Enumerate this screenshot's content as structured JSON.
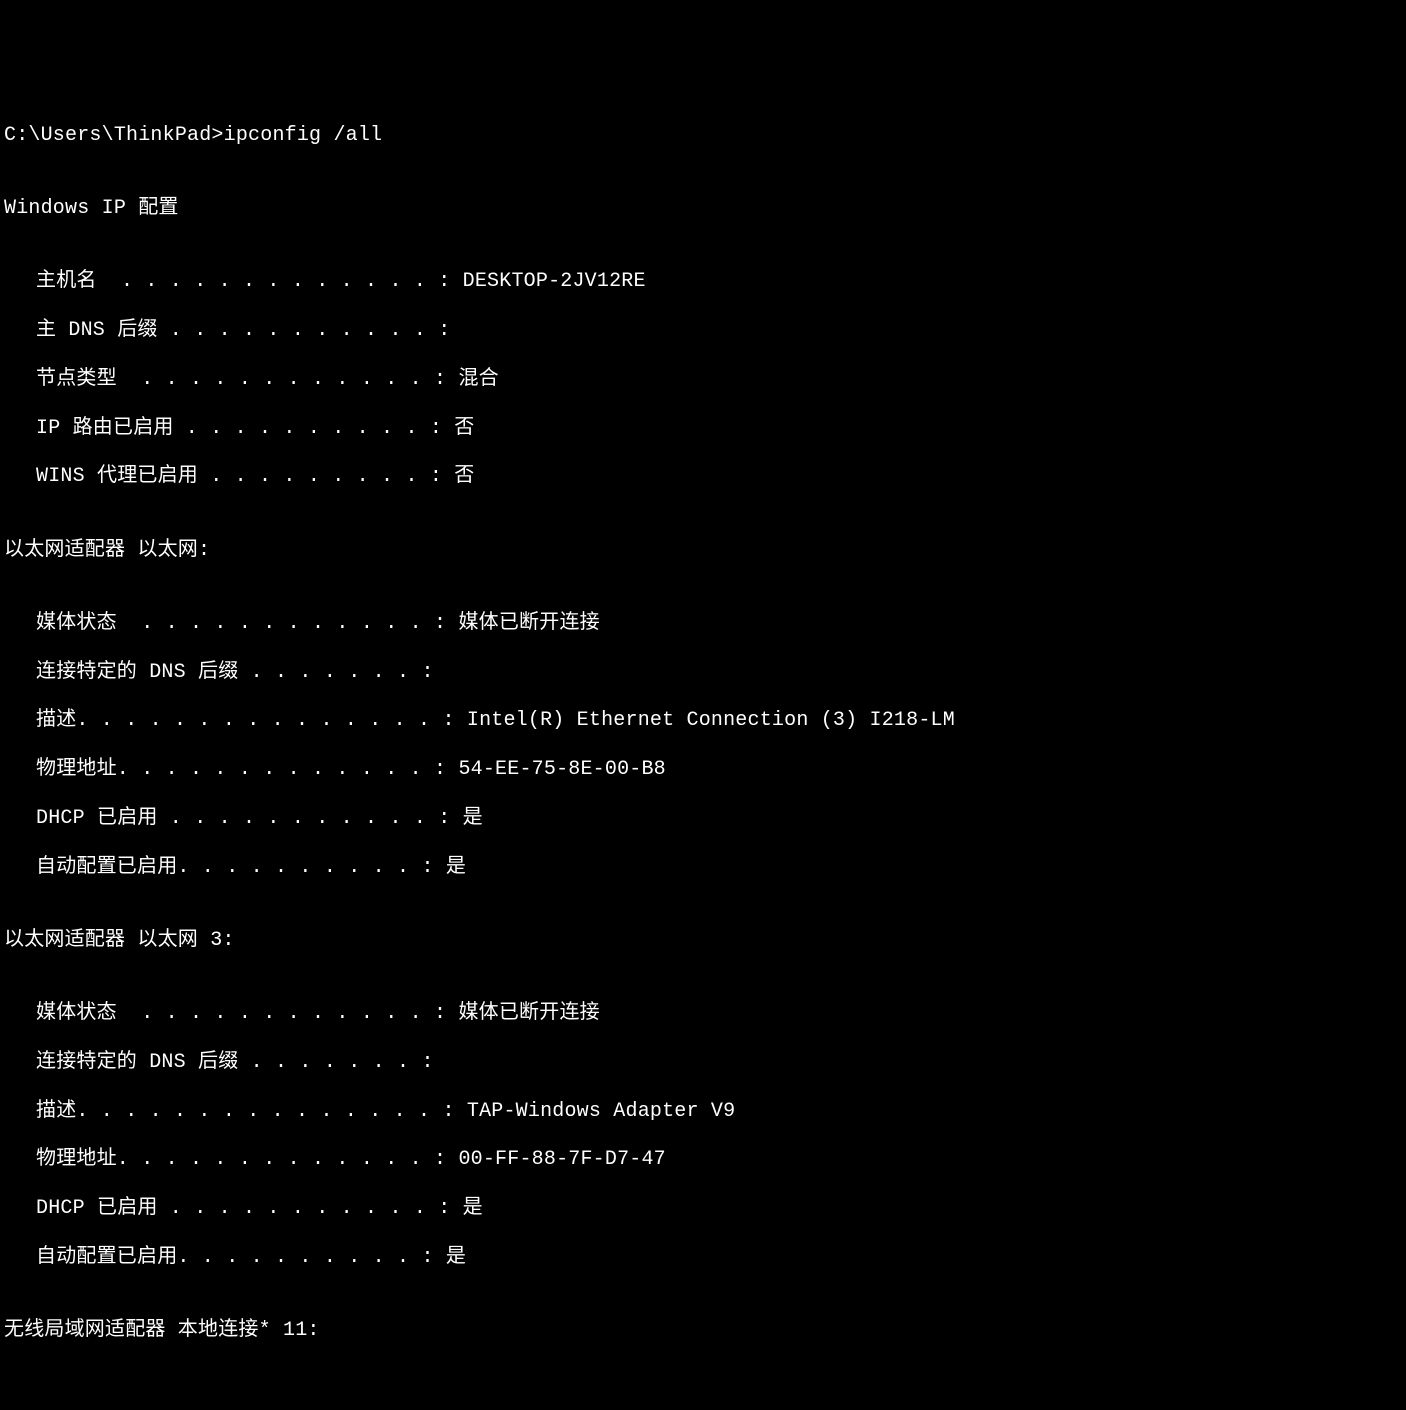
{
  "prompt": "C:\\Users\\ThinkPad>ipconfig /all",
  "blank": "",
  "header": "Windows IP 配置",
  "host": {
    "hostname_label": "主机名  . . . . . . . . . . . . . : DESKTOP-2JV12RE",
    "dns_suffix_label": "主 DNS 后缀 . . . . . . . . . . . :",
    "node_type_label": "节点类型  . . . . . . . . . . . . : 混合",
    "ip_routing_label": "IP 路由已启用 . . . . . . . . . . : 否",
    "wins_proxy_label": "WINS 代理已启用 . . . . . . . . . : 否"
  },
  "adapter1": {
    "title": "以太网适配器 以太网:",
    "media_state": "媒体状态  . . . . . . . . . . . . : 媒体已断开连接",
    "dns_suffix": "连接特定的 DNS 后缀 . . . . . . . :",
    "description": "描述. . . . . . . . . . . . . . . : Intel(R) Ethernet Connection (3) I218-LM",
    "physical_addr": "物理地址. . . . . . . . . . . . . : 54-EE-75-8E-00-B8",
    "dhcp_enabled": "DHCP 已启用 . . . . . . . . . . . : 是",
    "autoconfig": "自动配置已启用. . . . . . . . . . : 是"
  },
  "adapter2": {
    "title": "以太网适配器 以太网 3:",
    "media_state": "媒体状态  . . . . . . . . . . . . : 媒体已断开连接",
    "dns_suffix": "连接特定的 DNS 后缀 . . . . . . . :",
    "description": "描述. . . . . . . . . . . . . . . : TAP-Windows Adapter V9",
    "physical_addr": "物理地址. . . . . . . . . . . . . : 00-FF-88-7F-D7-47",
    "dhcp_enabled": "DHCP 已启用 . . . . . . . . . . . : 是",
    "autoconfig": "自动配置已启用. . . . . . . . . . : 是"
  },
  "adapter3": {
    "title": "无线局域网适配器 本地连接* 11:"
  }
}
